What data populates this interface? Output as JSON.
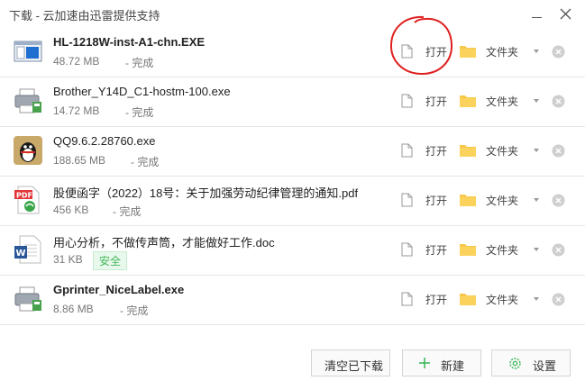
{
  "window": {
    "title": "下载 - 云加速由迅雷提供支持"
  },
  "downloads": [
    {
      "name": "HL-1218W-inst-A1-chn.EXE",
      "size": "48.72 MB",
      "status": "- 完成",
      "icon": "installer-window-icon"
    },
    {
      "name": "Brother_Y14D_C1-hostm-100.exe",
      "size": "14.72 MB",
      "status": "- 完成",
      "icon": "printer-setup-icon"
    },
    {
      "name": "QQ9.6.2.28760.exe",
      "size": "188.65 MB",
      "status": "- 完成",
      "icon": "qq-penguin-icon"
    },
    {
      "name": "股便函字（2022）18号：关于加强劳动纪律管理的通知.pdf",
      "size": "456 KB",
      "status": "- 完成",
      "icon": "pdf-file-icon"
    },
    {
      "name": "用心分析，不做传声筒，才能做好工作.doc",
      "size": "31 KB",
      "badge": "安全",
      "icon": "word-doc-icon"
    },
    {
      "name": "Gprinter_NiceLabel.exe",
      "size": "8.86 MB",
      "status": "- 完成",
      "icon": "printer-setup-icon"
    }
  ],
  "actions": {
    "open_label": "打开",
    "folder_label": "文件夹"
  },
  "footer": {
    "clear_label": "清空已下载",
    "new_label": "新建",
    "settings_label": "设置"
  },
  "colors": {
    "folder": "#f7c84a",
    "safe_badge": "#41b95a",
    "annotation": "#e02020"
  }
}
